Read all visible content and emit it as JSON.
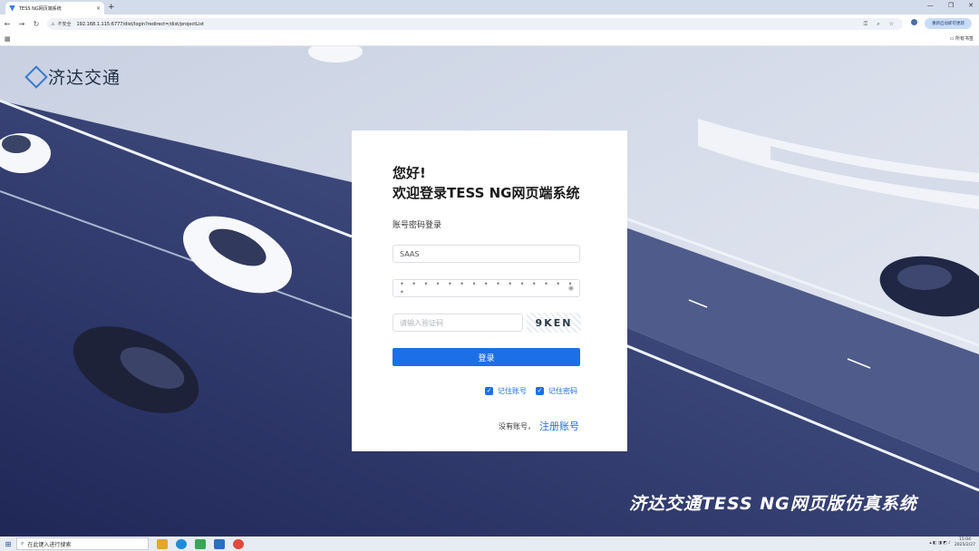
{
  "browser": {
    "tab_title": "TESS NG网页端系统",
    "tab_close": "×",
    "new_tab": "+",
    "window_controls": [
      "—",
      "❐",
      "✕"
    ],
    "nav": [
      "←",
      "→",
      "↻"
    ],
    "security_label": "不安全",
    "url": "192.168.1.115:6777/dist/login?redirect=/dist/projectList",
    "restart_label": "重新启动即可更新",
    "all_bookmarks": "所有书签"
  },
  "logo": {
    "text": "济达交通"
  },
  "login": {
    "greeting": "您好!",
    "welcome": "欢迎登录TESS NG网页端系统",
    "method_label": "账号密码登录",
    "username_value": "SAAS",
    "password_mask": "• • • • • • • • • • • • • • • •",
    "captcha_placeholder": "请输入验证码",
    "captcha_image_text": "9KEN",
    "submit_label": "登录",
    "remember_account": "记住账号",
    "remember_password": "记住密码",
    "no_account": "没有账号，",
    "register_link": "注册账号"
  },
  "slogan": "济达交通TESS  NG网页版仿真系统",
  "taskbar": {
    "search_placeholder": "在此键入进行搜索",
    "time": "15:04",
    "date": "2025/2/27"
  },
  "colors": {
    "accent": "#1d6fe8",
    "scene_dark": "#2a3260",
    "scene_light": "#d4dbe8"
  }
}
